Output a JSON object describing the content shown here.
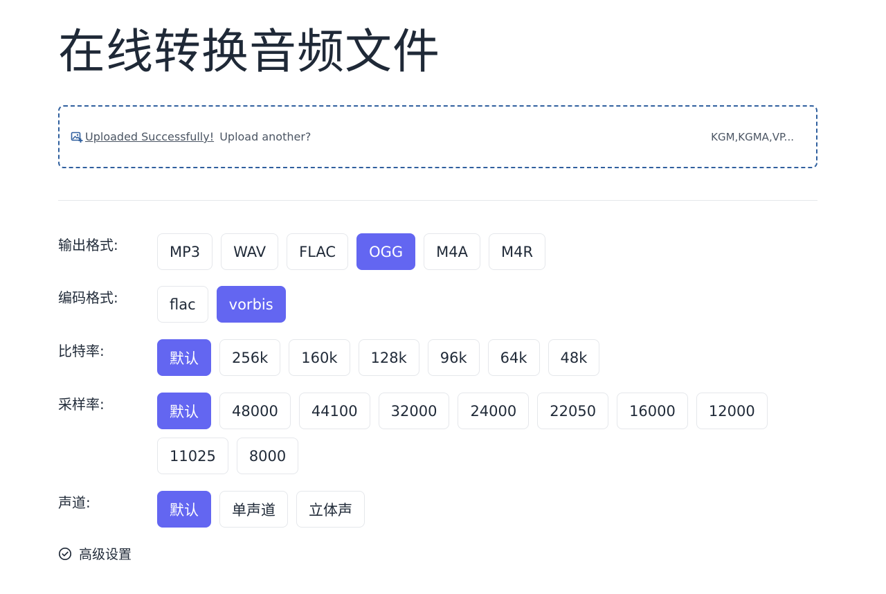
{
  "title": "在线转换音频文件",
  "upload": {
    "link_text": "Uploaded Successfully!",
    "suffix_text": " Upload another?",
    "formats_text": "KGM,KGMA,VP..."
  },
  "rows": [
    {
      "label": "输出格式:",
      "options": [
        "MP3",
        "WAV",
        "FLAC",
        "OGG",
        "M4A",
        "M4R"
      ],
      "selected": 3
    },
    {
      "label": "编码格式:",
      "options": [
        "flac",
        "vorbis"
      ],
      "selected": 1
    },
    {
      "label": "比特率:",
      "options": [
        "默认",
        "256k",
        "160k",
        "128k",
        "96k",
        "64k",
        "48k"
      ],
      "selected": 0
    },
    {
      "label": "采样率:",
      "options": [
        "默认",
        "48000",
        "44100",
        "32000",
        "24000",
        "22050",
        "16000",
        "12000",
        "11025",
        "8000"
      ],
      "selected": 0
    },
    {
      "label": "声道:",
      "options": [
        "默认",
        "单声道",
        "立体声"
      ],
      "selected": 0
    }
  ],
  "advanced": {
    "label": "高级设置"
  },
  "colors": {
    "accent": "#6366f1",
    "dashed_border": "#2f5f9e",
    "text": "#1f2937"
  }
}
